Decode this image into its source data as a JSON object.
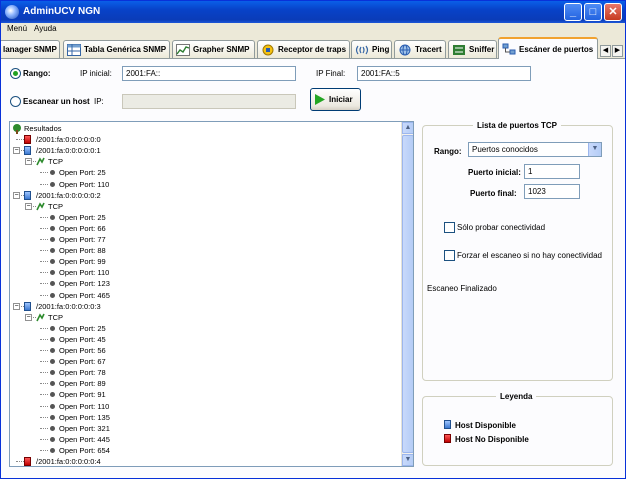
{
  "window": {
    "title": "AdminUCV NGN",
    "min_label": "_",
    "max_label": "□",
    "close_label": "✕"
  },
  "menu": {
    "items": [
      "Menú",
      "Ayuda"
    ]
  },
  "tabs": [
    {
      "label": "lanager SNMP",
      "icon": "none"
    },
    {
      "label": "Tabla Genérica SNMP",
      "icon": "table-icon"
    },
    {
      "label": "Grapher SNMP",
      "icon": "graph-icon"
    },
    {
      "label": "Receptor de traps",
      "icon": "trap-icon"
    },
    {
      "label": "Ping",
      "icon": "ping-icon"
    },
    {
      "label": "Tracert",
      "icon": "globe-icon"
    },
    {
      "label": "Sniffer",
      "icon": "sniffer-icon"
    },
    {
      "label": "Escáner de puertos",
      "icon": "network-icon"
    }
  ],
  "tab_nav": {
    "left": "◀",
    "right": "▶"
  },
  "form": {
    "rango_label": "Rango:",
    "ip_inicial_label": "IP inicial:",
    "ip_inicial_value": "2001:FA::",
    "ip_final_label": "IP Final:",
    "ip_final_value": "2001:FA::5",
    "single_host_label": "Escanear un host",
    "ip_label": "IP:",
    "ip_value": "",
    "start_button": "Iniciar"
  },
  "tree": {
    "rows": [
      {
        "level": 0,
        "type": "root",
        "text": "Resultados"
      },
      {
        "level": 1,
        "type": "host-off",
        "text": "/2001:fa:0:0:0:0:0:0"
      },
      {
        "level": 1,
        "type": "host-on",
        "text": "/2001:fa:0:0:0:0:0:1",
        "expanded": true
      },
      {
        "level": 2,
        "type": "proto",
        "text": "TCP",
        "expanded": true
      },
      {
        "level": 3,
        "type": "port",
        "text": "Open Port: 25"
      },
      {
        "level": 3,
        "type": "port",
        "text": "Open Port: 110"
      },
      {
        "level": 1,
        "type": "host-on",
        "text": "/2001:fa:0:0:0:0:0:2",
        "expanded": true
      },
      {
        "level": 2,
        "type": "proto",
        "text": "TCP",
        "expanded": true
      },
      {
        "level": 3,
        "type": "port",
        "text": "Open Port: 25"
      },
      {
        "level": 3,
        "type": "port",
        "text": "Open Port: 66"
      },
      {
        "level": 3,
        "type": "port",
        "text": "Open Port: 77"
      },
      {
        "level": 3,
        "type": "port",
        "text": "Open Port: 88"
      },
      {
        "level": 3,
        "type": "port",
        "text": "Open Port: 99"
      },
      {
        "level": 3,
        "type": "port",
        "text": "Open Port: 110"
      },
      {
        "level": 3,
        "type": "port",
        "text": "Open Port: 123"
      },
      {
        "level": 3,
        "type": "port",
        "text": "Open Port: 465"
      },
      {
        "level": 1,
        "type": "host-on",
        "text": "/2001:fa:0:0:0:0:0:3",
        "expanded": true
      },
      {
        "level": 2,
        "type": "proto",
        "text": "TCP",
        "expanded": true
      },
      {
        "level": 3,
        "type": "port",
        "text": "Open Port: 25"
      },
      {
        "level": 3,
        "type": "port",
        "text": "Open Port: 45"
      },
      {
        "level": 3,
        "type": "port",
        "text": "Open Port: 56"
      },
      {
        "level": 3,
        "type": "port",
        "text": "Open Port: 67"
      },
      {
        "level": 3,
        "type": "port",
        "text": "Open Port: 78"
      },
      {
        "level": 3,
        "type": "port",
        "text": "Open Port: 89"
      },
      {
        "level": 3,
        "type": "port",
        "text": "Open Port: 91"
      },
      {
        "level": 3,
        "type": "port",
        "text": "Open Port: 110"
      },
      {
        "level": 3,
        "type": "port",
        "text": "Open Port: 135"
      },
      {
        "level": 3,
        "type": "port",
        "text": "Open Port: 321"
      },
      {
        "level": 3,
        "type": "port",
        "text": "Open Port: 445"
      },
      {
        "level": 3,
        "type": "port",
        "text": "Open Port: 654"
      },
      {
        "level": 1,
        "type": "host-off",
        "text": "/2001:fa:0:0:0:0:0:4"
      }
    ]
  },
  "tcp_panel": {
    "title": "Lista de puertos TCP",
    "rango_label": "Rango:",
    "rango_value": "Puertos conocidos",
    "puerto_inicial_label": "Puerto inicial:",
    "puerto_inicial_value": "1",
    "puerto_final_label": "Puerto final:",
    "puerto_final_value": "1023",
    "check_conectividad": "Sólo probar conectividad",
    "check_forzar": "Forzar el escaneo si no hay conectividad",
    "status": "Escaneo Finalizado"
  },
  "legend": {
    "title": "Leyenda",
    "available": "Host Disponible",
    "unavailable": "Host No Disponible"
  },
  "colors": {
    "title_bar": "#0842c8",
    "host_on": "#3c78d0",
    "host_off": "#c00000",
    "tab_highlight": "#f1a230"
  }
}
